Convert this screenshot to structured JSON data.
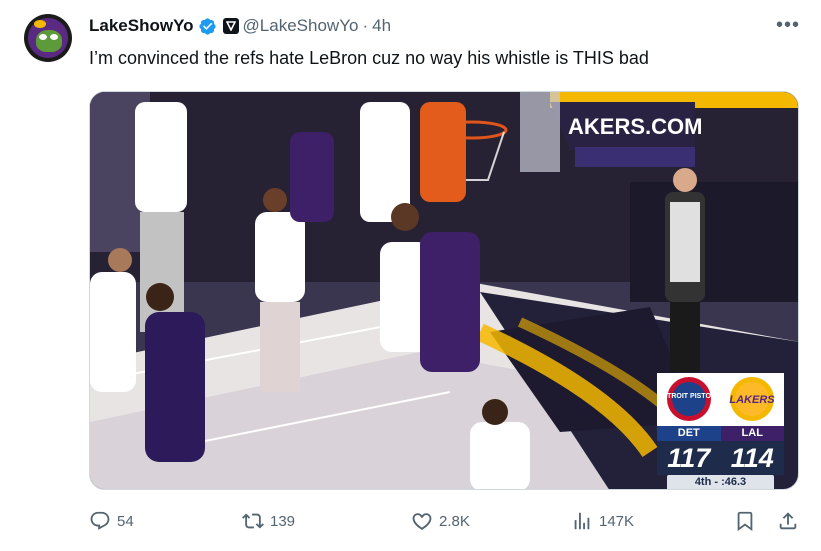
{
  "post": {
    "author_name": "LakeShowYo",
    "handle": "@LakeShowYo",
    "separator": "·",
    "time": "4h",
    "more_label": "•••",
    "text": "I’m convinced the refs hate LeBron cuz no way his whistle is THIS bad"
  },
  "media": {
    "arena_banner": "AKERS.COM",
    "scorebug": {
      "home_team_logo_text": "DETROIT PISTONS",
      "away_team_logo_text": "LAKERS",
      "home_abbr": "DET",
      "away_abbr": "LAL",
      "home_score": "117",
      "away_score": "114",
      "clock": "4th - :46.3",
      "colors": {
        "det": "#1d428a",
        "lal": "#3d2067",
        "lakers_gold": "#f5b800"
      }
    }
  },
  "actions": {
    "replies": "54",
    "reposts": "139",
    "likes": "2.8K",
    "views": "147K"
  },
  "icons": [
    "verified-badge-icon",
    "affiliate-icon",
    "more-icon",
    "reply-icon",
    "repost-icon",
    "like-icon",
    "views-icon",
    "bookmark-icon",
    "share-icon"
  ],
  "colors": {
    "secondary_text": "#536471",
    "verified_blue": "#1d9bf0"
  }
}
